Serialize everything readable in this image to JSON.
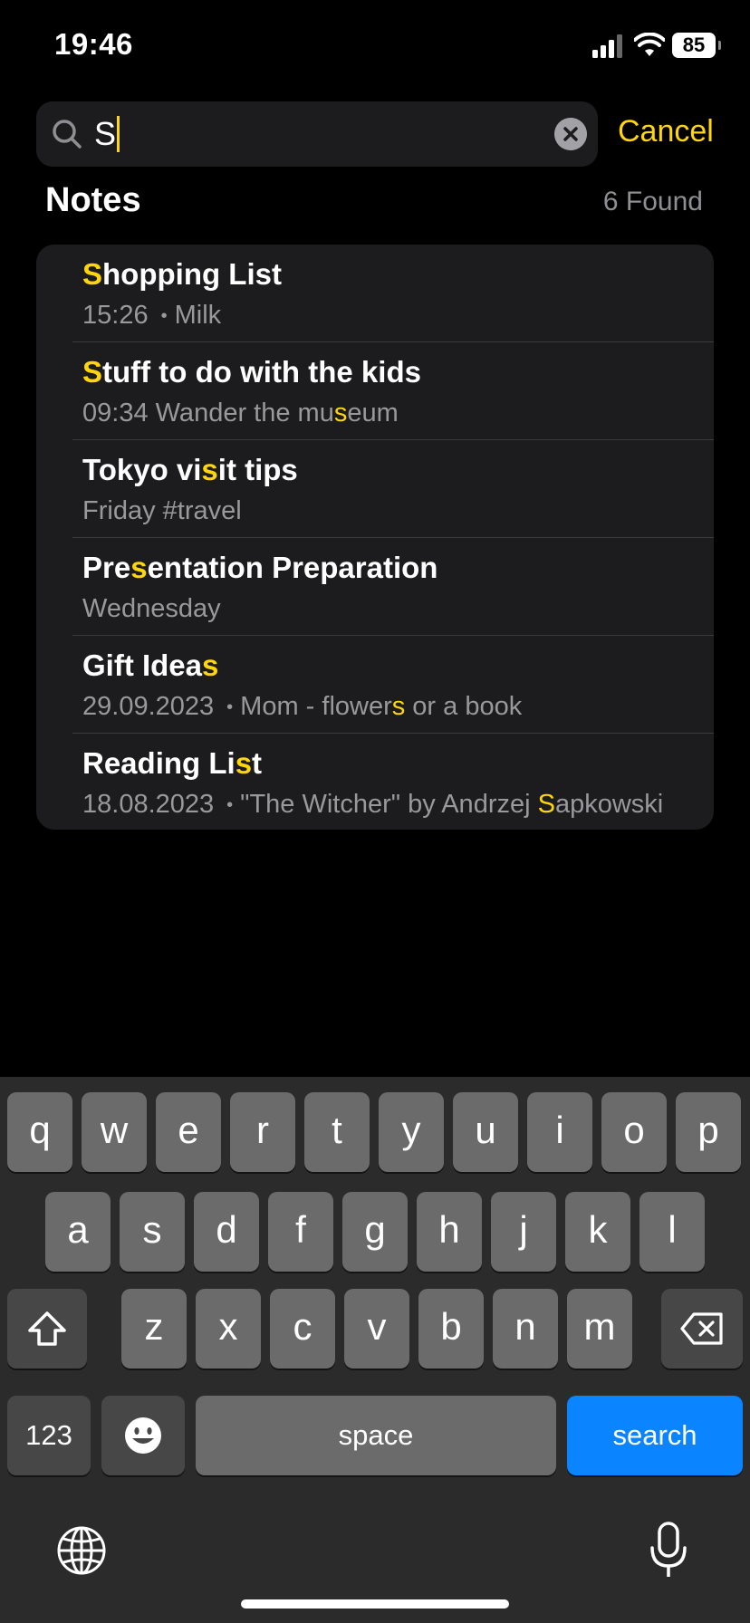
{
  "status_bar": {
    "time": "19:46",
    "battery": "85"
  },
  "search": {
    "query": "S",
    "cancel_label": "Cancel"
  },
  "section": {
    "title": "Notes",
    "found": "6 Found"
  },
  "notes": [
    {
      "title": [
        {
          "t": "S",
          "h": true
        },
        {
          "t": "hopping List",
          "h": false
        }
      ],
      "date": "15:26",
      "dot": true,
      "preview": [
        {
          "t": "Milk",
          "h": false
        }
      ]
    },
    {
      "title": [
        {
          "t": "S",
          "h": true
        },
        {
          "t": "tuff to do with the kids",
          "h": false
        }
      ],
      "date": "09:34",
      "dot": false,
      "preview": [
        {
          "t": "Wander the mu",
          "h": false
        },
        {
          "t": "s",
          "h": true
        },
        {
          "t": "eum",
          "h": false
        }
      ]
    },
    {
      "title": [
        {
          "t": "Tokyo vi",
          "h": false
        },
        {
          "t": "s",
          "h": true
        },
        {
          "t": "it tips",
          "h": false
        }
      ],
      "date": "Friday",
      "dot": false,
      "preview": [
        {
          "t": "#travel",
          "h": false
        }
      ]
    },
    {
      "title": [
        {
          "t": "Pre",
          "h": false
        },
        {
          "t": "s",
          "h": true
        },
        {
          "t": "entation Preparation",
          "h": false
        }
      ],
      "date": "Wednesday",
      "dot": false,
      "preview": []
    },
    {
      "title": [
        {
          "t": "Gift Idea",
          "h": false
        },
        {
          "t": "s",
          "h": true
        }
      ],
      "date": "29.09.2023",
      "dot": true,
      "preview": [
        {
          "t": "Mom - flower",
          "h": false
        },
        {
          "t": "s",
          "h": true
        },
        {
          "t": " or a book",
          "h": false
        }
      ]
    },
    {
      "title": [
        {
          "t": "Reading Li",
          "h": false
        },
        {
          "t": "s",
          "h": true
        },
        {
          "t": "t",
          "h": false
        }
      ],
      "date": "18.08.2023",
      "dot": true,
      "preview": [
        {
          "t": "\"The Witcher\" by Andrzej ",
          "h": false
        },
        {
          "t": "S",
          "h": true
        },
        {
          "t": "apkowski",
          "h": false
        }
      ]
    }
  ],
  "keyboard": {
    "row1": [
      "q",
      "w",
      "e",
      "r",
      "t",
      "y",
      "u",
      "i",
      "o",
      "p"
    ],
    "row2": [
      "a",
      "s",
      "d",
      "f",
      "g",
      "h",
      "j",
      "k",
      "l"
    ],
    "row3": [
      "z",
      "x",
      "c",
      "v",
      "b",
      "n",
      "m"
    ],
    "numbers_label": "123",
    "space_label": "space",
    "search_label": "search"
  },
  "colors": {
    "accent": "#ffd60a",
    "search_key": "#0a84ff",
    "card_bg": "#1c1c1e"
  }
}
